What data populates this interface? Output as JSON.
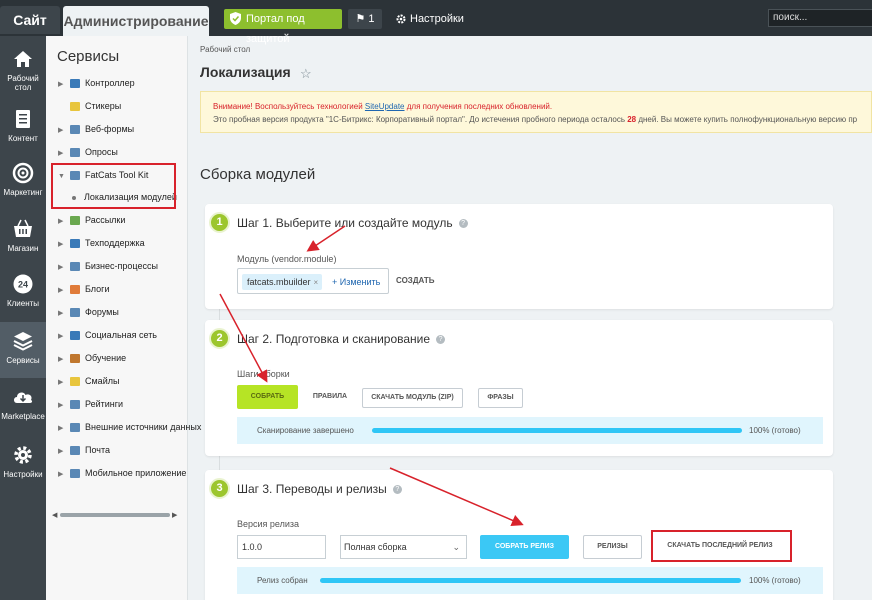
{
  "topbar": {
    "site_tab": "Сайт",
    "admin_tab": "Администрирование",
    "portal_button": "Портал под защитой",
    "notifications_count": "1",
    "settings_label": "Настройки",
    "search_placeholder": "поиск..."
  },
  "leftbar": {
    "items": [
      {
        "label_line1": "Рабочий",
        "label_line2": "стол",
        "icon": "home-icon"
      },
      {
        "label_line1": "Контент",
        "label_line2": "",
        "icon": "document-icon"
      },
      {
        "label_line1": "Маркетинг",
        "label_line2": "",
        "icon": "target-icon"
      },
      {
        "label_line1": "Магазин",
        "label_line2": "",
        "icon": "cart-icon"
      },
      {
        "label_line1": "Клиенты",
        "label_line2": "",
        "icon": "clients-24-icon"
      },
      {
        "label_line1": "Сервисы",
        "label_line2": "",
        "icon": "layers-icon"
      },
      {
        "label_line1": "Marketplace",
        "label_line2": "",
        "icon": "cloud-download-icon"
      },
      {
        "label_line1": "Настройки",
        "label_line2": "",
        "icon": "gear-icon"
      }
    ]
  },
  "sidebar": {
    "title": "Сервисы",
    "items": [
      {
        "label": "Контроллер",
        "arrow": "▶",
        "color": "#3a7ab8"
      },
      {
        "label": "Стикеры",
        "arrow": "",
        "color": "#e8c53d"
      },
      {
        "label": "Веб-формы",
        "arrow": "▶",
        "color": "#5a88b5"
      },
      {
        "label": "Опросы",
        "arrow": "▶",
        "color": "#5a88b5"
      },
      {
        "label": "FatCats Tool Kit",
        "arrow": "▼",
        "color": "#5a88b5"
      },
      {
        "label": "Рассылки",
        "arrow": "▶",
        "color": "#6aa84f"
      },
      {
        "label": "Техподдержка",
        "arrow": "▶",
        "color": "#3a7ab8"
      },
      {
        "label": "Бизнес-процессы",
        "arrow": "▶",
        "color": "#5a88b5"
      },
      {
        "label": "Блоги",
        "arrow": "▶",
        "color": "#e07b39"
      },
      {
        "label": "Форумы",
        "arrow": "▶",
        "color": "#5a88b5"
      },
      {
        "label": "Социальная сеть",
        "arrow": "▶",
        "color": "#3a7ab8"
      },
      {
        "label": "Обучение",
        "arrow": "▶",
        "color": "#c0772e"
      },
      {
        "label": "Смайлы",
        "arrow": "▶",
        "color": "#e8c53d"
      },
      {
        "label": "Рейтинги",
        "arrow": "▶",
        "color": "#5a88b5"
      },
      {
        "label": "Внешние источники данных",
        "arrow": "▶",
        "color": "#5a88b5"
      },
      {
        "label": "Почта",
        "arrow": "▶",
        "color": "#5a88b5"
      },
      {
        "label": "Мобильное приложение",
        "arrow": "▶",
        "color": "#5a88b5"
      }
    ],
    "subitem": "Локализация модулей"
  },
  "main": {
    "breadcrumb": "Рабочий стол",
    "page_title": "Локализация",
    "warning_line1_pre": "Внимание! Воспользуйтесь технологией ",
    "warning_link": "SiteUpdate",
    "warning_line1_post": " для получения последних обновлений.",
    "warning_line2_pre": "Это пробная версия продукта \"1С-Битрикс: Корпоративный портал\". До истечения пробного периода осталось ",
    "warning_days": "28",
    "warning_line2_post": " дней. Вы можете купить полнофункциональную версию пр",
    "section_title": "Сборка модулей"
  },
  "step1": {
    "number": "1",
    "title": "Шаг 1. Выберите или создайте модуль",
    "help": "?",
    "field_label": "Модуль (vendor.module)",
    "tag_value": "fatcats.mbuilder",
    "tag_remove": "×",
    "change_link": "+ Изменить",
    "create_button": "СОЗДАТЬ"
  },
  "step2": {
    "number": "2",
    "title": "Шаг 2. Подготовка и сканирование",
    "help": "?",
    "steps_label": "Шаги сборки",
    "btn_build": "СОБРАТЬ",
    "btn_rules": "ПРАВИЛА",
    "btn_download_zip": "СКАЧАТЬ МОДУЛЬ (ZIP)",
    "btn_phrases": "ФРАЗЫ",
    "progress_text": "Сканирование завершено",
    "progress_fraction": 1.0,
    "progress_value": "100% (готово)"
  },
  "step3": {
    "number": "3",
    "title": "Шаг 3. Переводы и релизы",
    "help": "?",
    "version_label": "Версия релиза",
    "version_value": "1.0.0",
    "build_type": "Полная сборка",
    "btn_build_release": "СОБРАТЬ РЕЛИЗ",
    "btn_releases": "РЕЛИЗЫ",
    "btn_download_latest": "СКАЧАТЬ ПОСЛЕДНИЙ РЕЛИЗ",
    "progress_text": "Релиз собран",
    "progress_fraction": 1.0,
    "progress_value": "100% (готово)"
  },
  "colors": {
    "accent_green": "#9cc62d",
    "button_green": "#b6e425",
    "button_blue": "#3bc8f5",
    "annotation_red": "#d8222b"
  }
}
